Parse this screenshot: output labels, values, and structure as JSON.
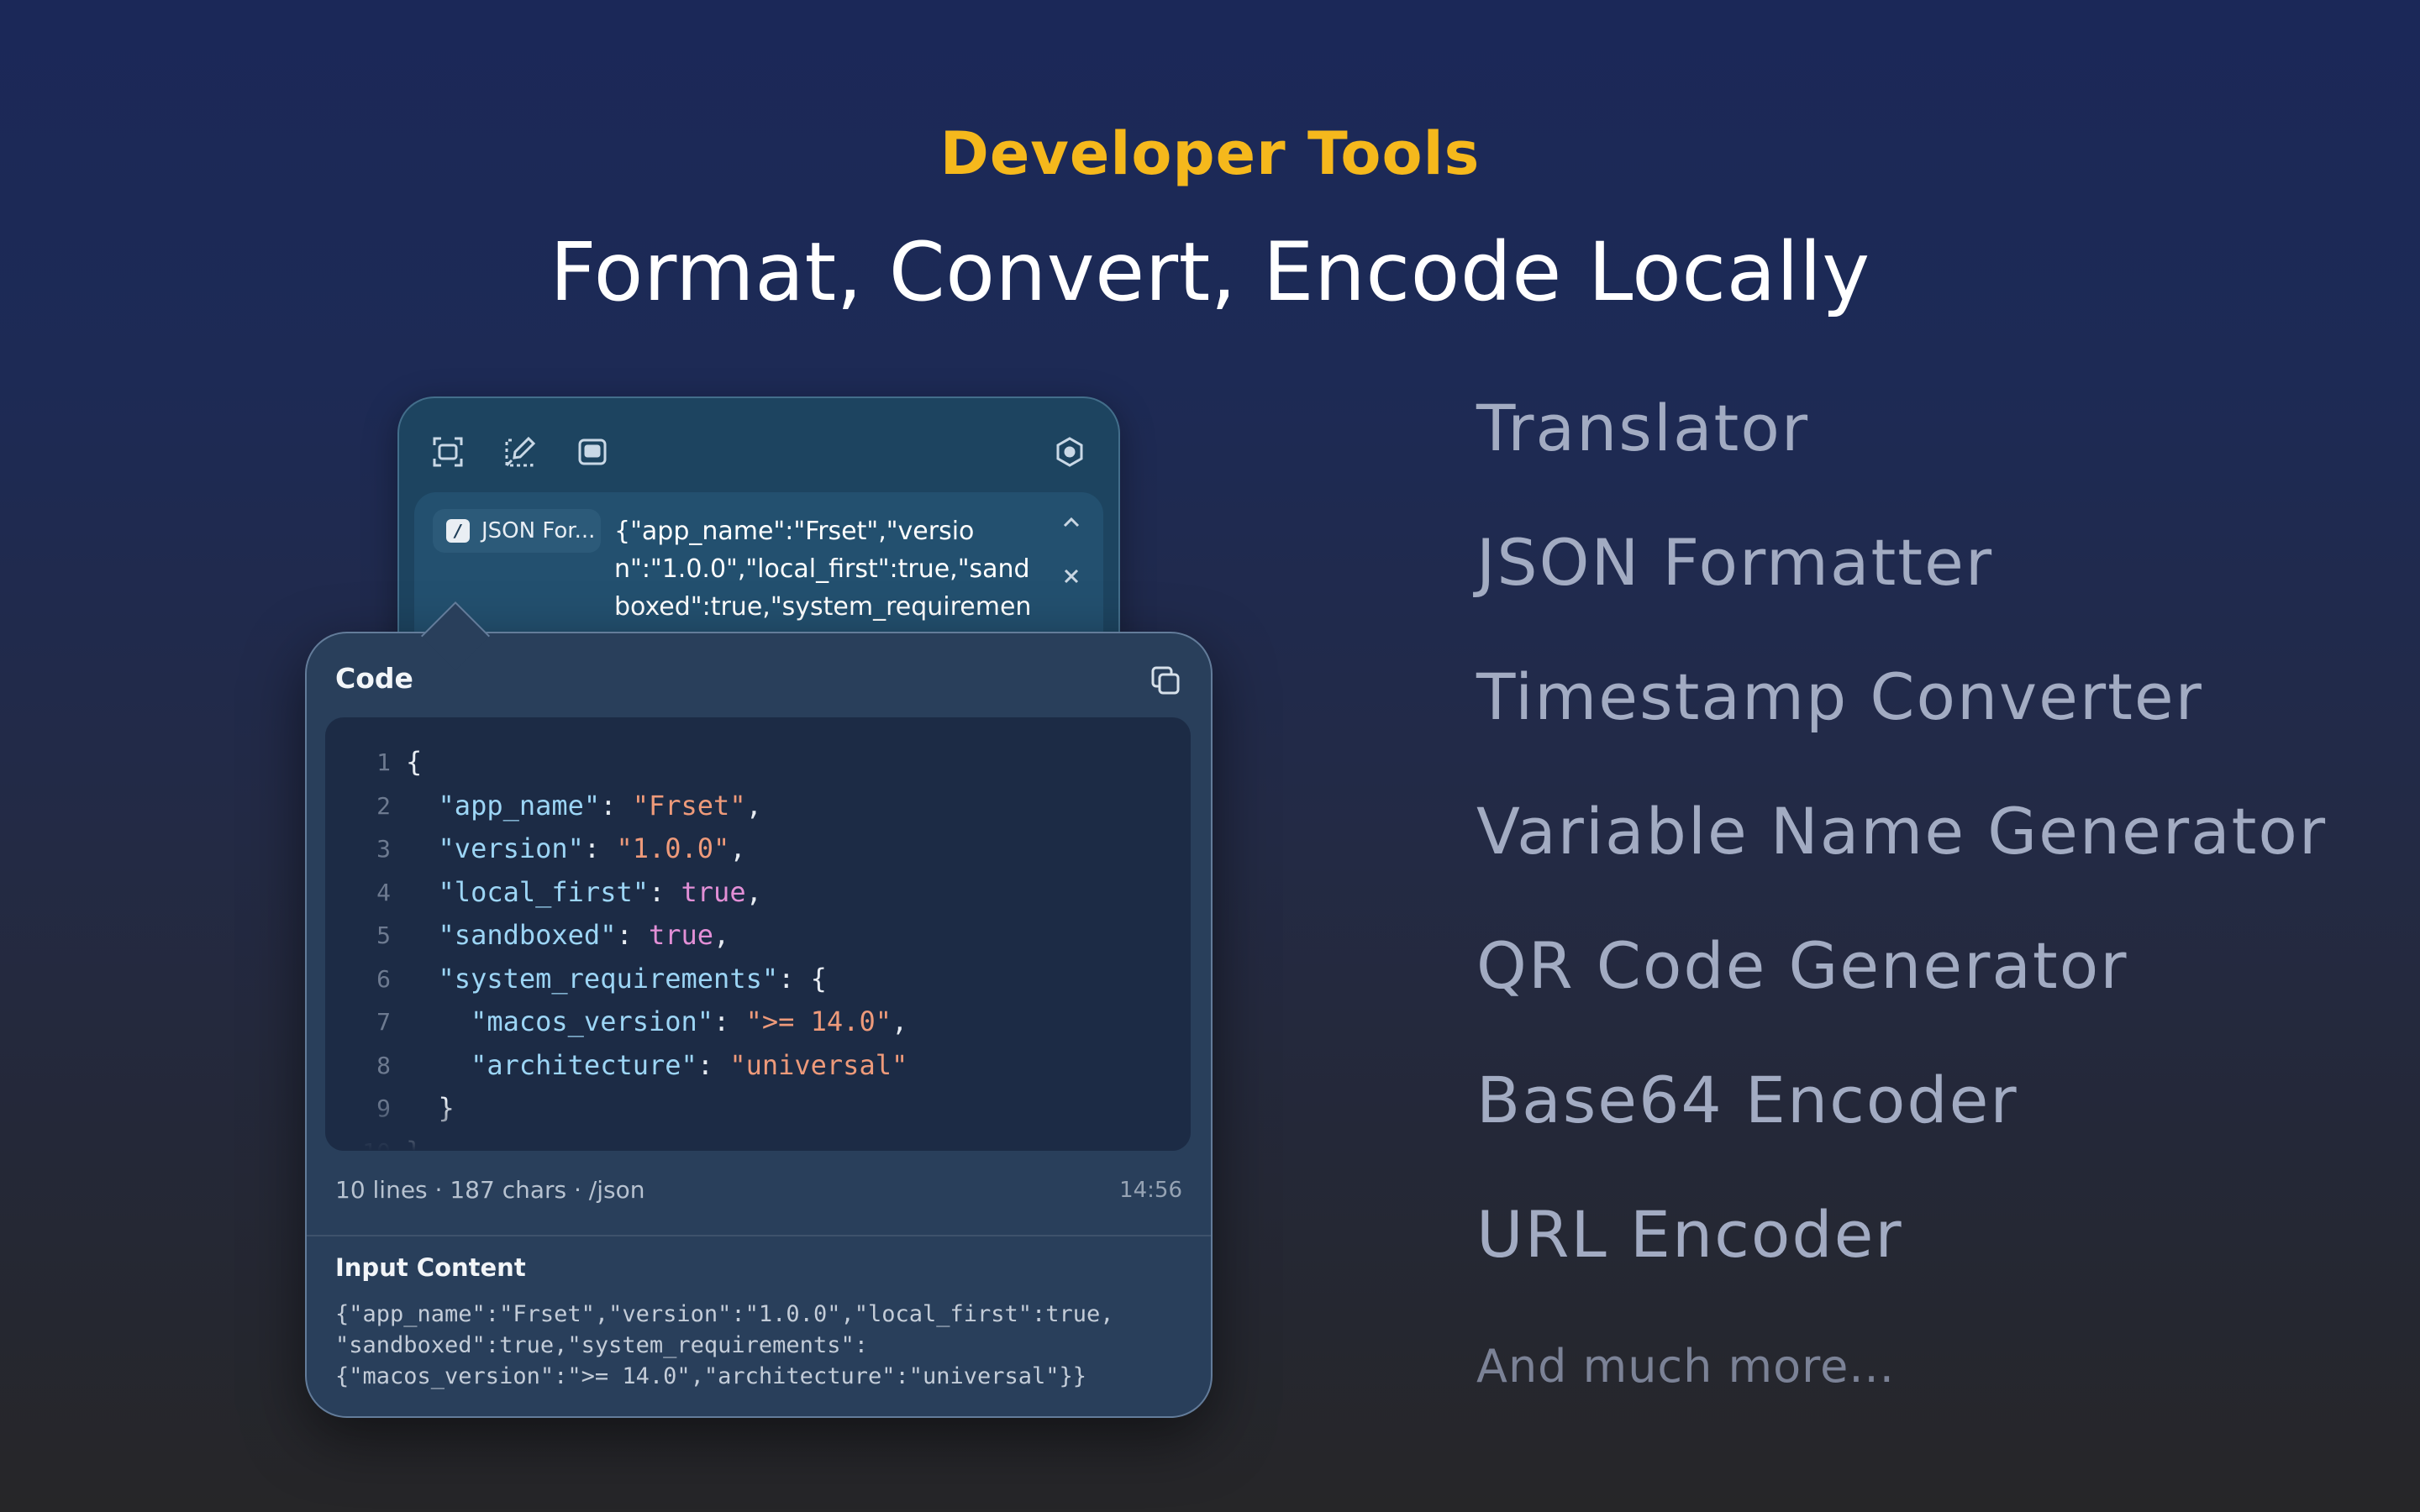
{
  "header": {
    "eyebrow": "Developer Tools",
    "headline": "Format, Convert, Encode Locally"
  },
  "features": [
    "Translator",
    "JSON Formatter",
    "Timestamp Converter",
    "Variable Name Generator",
    "QR Code Generator",
    "Base64 Encoder",
    "URL Encoder"
  ],
  "features_more": "And much more...",
  "toolbar": {
    "icons": [
      "screenshot-icon",
      "color-picker-icon",
      "window-icon",
      "settings-icon"
    ]
  },
  "input_row": {
    "tool_badge": "/",
    "tool_name": "JSON For...",
    "preview": "{\"app_name\":\"Frset\",\"version\":\"1.0.0\",\"local_first\":true,\"sandboxed\":true,\"system_requirements\":"
  },
  "result_panel": {
    "title": "Code",
    "code_lines": [
      {
        "n": "1",
        "parts": [
          [
            "p",
            "{"
          ]
        ]
      },
      {
        "n": "2",
        "parts": [
          [
            "p",
            "  "
          ],
          [
            "k",
            "\"app_name\""
          ],
          [
            "p",
            ": "
          ],
          [
            "s",
            "\"Frset\""
          ],
          [
            "p",
            ","
          ]
        ]
      },
      {
        "n": "3",
        "parts": [
          [
            "p",
            "  "
          ],
          [
            "k",
            "\"version\""
          ],
          [
            "p",
            ": "
          ],
          [
            "s",
            "\"1.0.0\""
          ],
          [
            "p",
            ","
          ]
        ]
      },
      {
        "n": "4",
        "parts": [
          [
            "p",
            "  "
          ],
          [
            "k",
            "\"local_first\""
          ],
          [
            "p",
            ": "
          ],
          [
            "b",
            "true"
          ],
          [
            "p",
            ","
          ]
        ]
      },
      {
        "n": "5",
        "parts": [
          [
            "p",
            "  "
          ],
          [
            "k",
            "\"sandboxed\""
          ],
          [
            "p",
            ": "
          ],
          [
            "b",
            "true"
          ],
          [
            "p",
            ","
          ]
        ]
      },
      {
        "n": "6",
        "parts": [
          [
            "p",
            "  "
          ],
          [
            "k",
            "\"system_requirements\""
          ],
          [
            "p",
            ": {"
          ]
        ]
      },
      {
        "n": "7",
        "parts": [
          [
            "p",
            "    "
          ],
          [
            "k",
            "\"macos_version\""
          ],
          [
            "p",
            ": "
          ],
          [
            "s",
            "\">= 14.0\""
          ],
          [
            "p",
            ","
          ]
        ]
      },
      {
        "n": "8",
        "parts": [
          [
            "p",
            "    "
          ],
          [
            "k",
            "\"architecture\""
          ],
          [
            "p",
            ": "
          ],
          [
            "s",
            "\"universal\""
          ]
        ]
      },
      {
        "n": "9",
        "parts": [
          [
            "p",
            "  }"
          ]
        ]
      },
      {
        "n": "10",
        "parts": [
          [
            "p",
            "}"
          ]
        ]
      }
    ],
    "stats": "10 lines · 187 chars · /json",
    "time": "14:56",
    "input_title": "Input Content",
    "input_raw": "{\"app_name\":\"Frset\",\"version\":\"1.0.0\",\"local_first\":true,\n\"sandboxed\":true,\"system_requirements\":\n{\"macos_version\":\">= 14.0\",\"architecture\":\"universal\"}}"
  },
  "colors": {
    "accent": "#f5b81c",
    "json_key": "#9cd5f5",
    "json_string": "#ee9a7a",
    "json_bool": "#e28fd6"
  }
}
